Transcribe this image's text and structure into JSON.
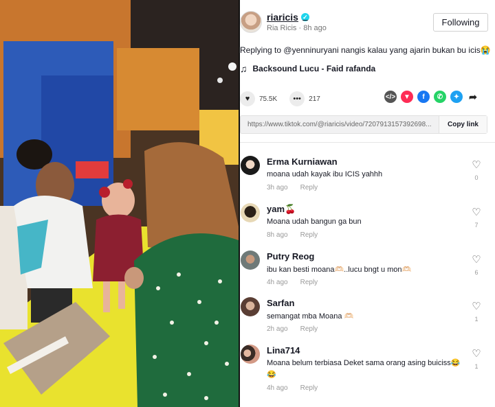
{
  "author": {
    "username": "riaricis",
    "display_name": "Ria Ricis",
    "time": "8h ago",
    "follow_label": "Following"
  },
  "caption": {
    "replying_prefix": "Replying to",
    "mention": "@yenninuryani",
    "text": "nangis kalau yang ajarin bukan bu icis😭"
  },
  "music": {
    "title": "Backsound Lucu - Faid rafanda"
  },
  "stats": {
    "likes": "75.5K",
    "comments": "217"
  },
  "share_icons": [
    "embed-icon",
    "send-icon",
    "facebook-icon",
    "whatsapp-icon",
    "twitter-icon",
    "share-arrow-icon"
  ],
  "link": {
    "url": "https://www.tiktok.com/@riaricis/video/7207913157392698...",
    "copy_label": "Copy link"
  },
  "comments": [
    {
      "name": "Erma Kurniawan",
      "text": "moana udah kayak ibu ICIS yahhh",
      "time": "3h ago",
      "reply": "Reply",
      "likes": "0"
    },
    {
      "name": "yam🍒",
      "text": "Moana udah bangun ga bun",
      "time": "8h ago",
      "reply": "Reply",
      "likes": "7"
    },
    {
      "name": "Putry Reog",
      "text": "ibu kan besti moana🫶🏻..lucu bngt u mon🫶🏻",
      "time": "4h ago",
      "reply": "Reply",
      "likes": "6"
    },
    {
      "name": "Sarfan",
      "text": "semangat mba Moana 🫶🏻",
      "time": "2h ago",
      "reply": "Reply",
      "likes": "1"
    },
    {
      "name": "Lina714",
      "text": "Moana belum terbiasa Deket sama orang asing buiciss😂😂",
      "time": "4h ago",
      "reply": "Reply",
      "likes": "1"
    }
  ],
  "colors": {
    "verified": "#20d5ec",
    "facebook": "#1877f2",
    "whatsapp": "#25d366",
    "twitter": "#1da1f2",
    "send": "#fe2c55"
  }
}
